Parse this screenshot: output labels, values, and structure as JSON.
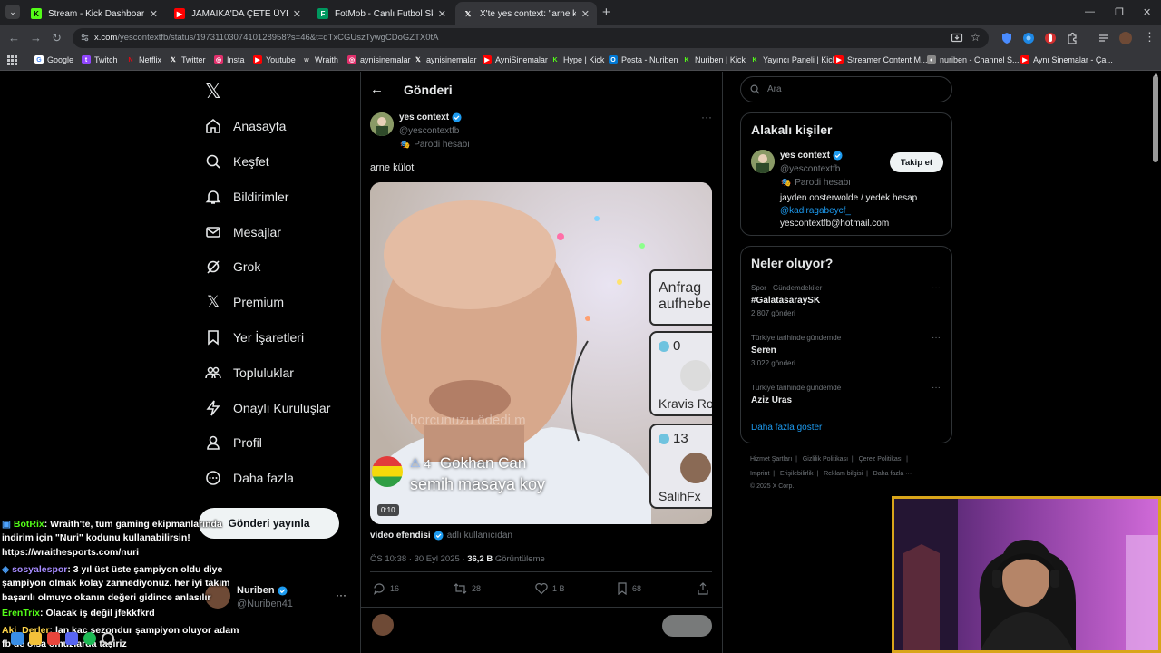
{
  "browser": {
    "tabs": [
      {
        "label": "Stream - Kick Dashboard",
        "icon": "kick-icon",
        "color": "#53fc18"
      },
      {
        "label": "JAMAİKA'DA ÇETE ÜYELERİYLE ...",
        "icon": "youtube-icon",
        "color": "#ff0000"
      },
      {
        "label": "FotMob - Canlı Futbol Skorları",
        "icon": "fotmob-icon",
        "color": "#00985f"
      },
      {
        "label": "X'te yes context: \"arne külot htt...",
        "icon": "x-icon",
        "color": "#000000"
      }
    ],
    "new_tab": "+",
    "url_domain": "x.com",
    "url_path": "/yescontextfb/status/1973110307410128958?s=46&t=dTxCGUszTywgCDoGZTX0tA",
    "bookmarks": [
      {
        "label": "Google",
        "icon": "google-icon",
        "color": "#4285f4"
      },
      {
        "label": "Twitch",
        "icon": "twitch-icon",
        "color": "#9146ff"
      },
      {
        "label": "Netflix",
        "icon": "netflix-icon",
        "color": "#e50914"
      },
      {
        "label": "Twitter",
        "icon": "x-icon",
        "color": "#000000"
      },
      {
        "label": "Insta",
        "icon": "instagram-icon",
        "color": "#e1306c"
      },
      {
        "label": "Youtube",
        "icon": "youtube-icon",
        "color": "#ff0000"
      },
      {
        "label": "Wraith",
        "icon": "wraith-icon",
        "color": "#666666"
      },
      {
        "label": "aynisinemalar",
        "icon": "instagram-icon",
        "color": "#e1306c"
      },
      {
        "label": "aynisinemalar",
        "icon": "x-icon",
        "color": "#000000"
      },
      {
        "label": "AyniSinemalar",
        "icon": "youtube-icon",
        "color": "#ff0000"
      },
      {
        "label": "Hype | Kick",
        "icon": "kick-icon",
        "color": "#53fc18"
      },
      {
        "label": "Posta - Nuriben",
        "icon": "outlook-icon",
        "color": "#0078d4"
      },
      {
        "label": "Nuriben | Kick",
        "icon": "kick-icon",
        "color": "#53fc18"
      },
      {
        "label": "Yayıncı Paneli | Kick",
        "icon": "kick-icon",
        "color": "#53fc18"
      },
      {
        "label": "Streamer Content M...",
        "icon": "youtube-icon",
        "color": "#ff0000"
      },
      {
        "label": "nuriben - Channel S...",
        "icon": "channel-icon",
        "color": "#888888"
      },
      {
        "label": "Aynı Sinemalar - Ça...",
        "icon": "youtube-icon",
        "color": "#ff0000"
      }
    ]
  },
  "sidebar": {
    "items": [
      {
        "label": "Anasayfa",
        "icon": "home-icon"
      },
      {
        "label": "Keşfet",
        "icon": "search-icon"
      },
      {
        "label": "Bildirimler",
        "icon": "bell-icon"
      },
      {
        "label": "Mesajlar",
        "icon": "mail-icon"
      },
      {
        "label": "Grok",
        "icon": "grok-icon"
      },
      {
        "label": "Premium",
        "icon": "x-icon"
      },
      {
        "label": "Yer İşaretleri",
        "icon": "bookmark-icon"
      },
      {
        "label": "Topluluklar",
        "icon": "community-icon"
      },
      {
        "label": "Onaylı Kuruluşlar",
        "icon": "lightning-icon"
      },
      {
        "label": "Profil",
        "icon": "profile-icon"
      },
      {
        "label": "Daha fazla",
        "icon": "more-icon"
      }
    ],
    "post_button": "Gönderi yayınla",
    "account": {
      "name": "Nuriben",
      "handle": "@Nuriben41"
    }
  },
  "main": {
    "title": "Gönderi",
    "post": {
      "author": "yes context",
      "handle": "@yescontextfb",
      "parody": "Parodi hesabı",
      "text": "arne külot",
      "video_duration": "0:10",
      "video_overlay": {
        "banner": "Anfrag aufhebe",
        "badge1_count": "0",
        "badge1_name": "Kravis Ro",
        "badge2_count": "13",
        "badge2_name": "SalihFx",
        "chat_level": "4",
        "chat_user": "Gokhan Can",
        "chat_text": "semih masaya koy",
        "faded_text": "borcunuzu ödedi m"
      },
      "source_name": "video efendisi",
      "source_suffix": "adlı kullanıcıdan",
      "time": "ÖS 10:38 · 30 Eyl 2025 · ",
      "views": "36,2 B",
      "views_label": "Görüntüleme",
      "replies": "16",
      "reposts": "28",
      "likes": "1 B",
      "bookmarks": "68"
    }
  },
  "right": {
    "search_placeholder": "Ara",
    "related_title": "Alakalı kişiler",
    "related_person": {
      "name": "yes context",
      "handle": "@yescontextfb",
      "parody": "Parodi hesabı",
      "bio_line1": "jayden oosterwolde / yedek hesap",
      "bio_link": "@kadiragabeycf_",
      "bio_line3": "yescontextfb@hotmail.com",
      "follow": "Takip et"
    },
    "trends_title": "Neler oluyor?",
    "trends": [
      {
        "category": "Spor · Gündemdekiler",
        "name": "#GalatasaraySK",
        "count": "2.807 gönderi"
      },
      {
        "category": "Türkiye tarihinde gündemde",
        "name": "Seren",
        "count": "3.022 gönderi"
      },
      {
        "category": "Türkiye tarihinde gündemde",
        "name": "Aziz Uras",
        "count": ""
      }
    ],
    "show_more": "Daha fazla göster",
    "footer_line1": [
      "Hizmet Şartları",
      "Gizlilik Politikası",
      "Çerez Politikası"
    ],
    "footer_line2": [
      "Imprint",
      "Erişilebilirlik",
      "Reklam bilgisi",
      "Daha fazla ···"
    ],
    "copyright": "© 2025 X Corp."
  },
  "chat": {
    "lines": [
      {
        "user": "BotRix",
        "text": ": Wraith'te, tüm gaming ekipmanlarında"
      },
      {
        "user": "",
        "text": "indirim için \"Nuri\" kodunu kullanabilirsin!"
      },
      {
        "user": "",
        "text": "https://wraithesports.com/nuri"
      },
      {
        "user": "sosyalespor",
        "text": ": 3 yıl üst üste şampiyon oldu diye"
      },
      {
        "user": "",
        "text": "şampiyon olmak kolay zannediyonuz. her iyi takım"
      },
      {
        "user": "",
        "text": "başarılı olmuyo okanın değeri gidince anlasılır"
      },
      {
        "user": "ErenTrix",
        "text": ": Olacak iş değil jfekkfkrd"
      },
      {
        "user": "Aki_Derler",
        "text": ": lan kac sezondur şampiyon oluyor adam"
      },
      {
        "user": "",
        "text": "fb de olsa omuzlarda taşiriz"
      }
    ]
  },
  "colors": {
    "accent": "#1d9bf0",
    "kick": "#53fc18",
    "cam_border": "#d9a51a"
  }
}
